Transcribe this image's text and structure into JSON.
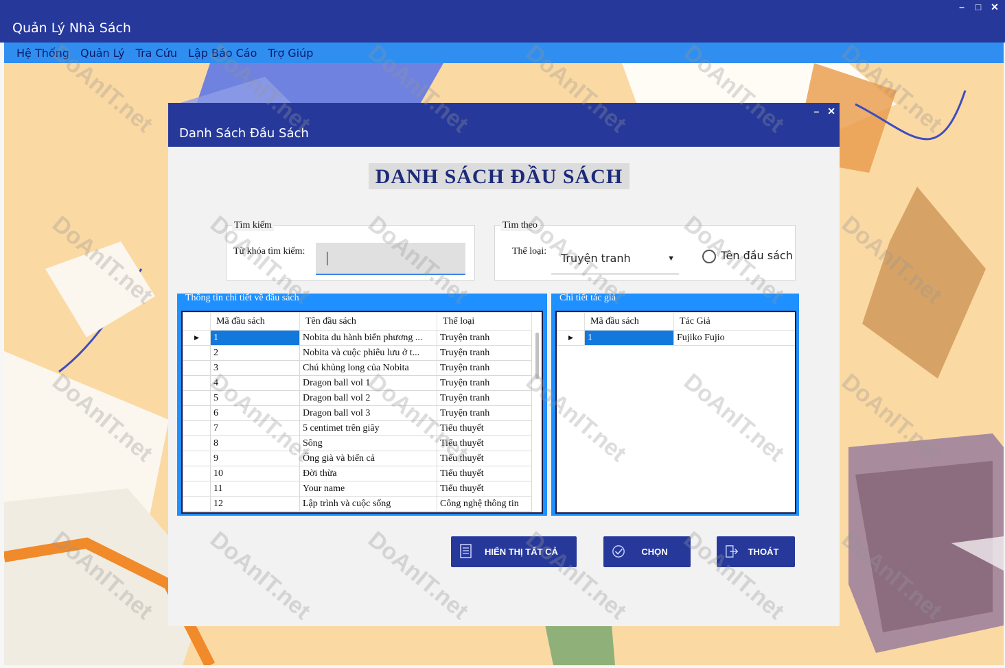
{
  "app": {
    "title": "Quản Lý Nhà Sách",
    "window_controls": [
      "–",
      "□",
      "✕"
    ]
  },
  "menu": [
    "Hệ Thống",
    "Quản Lý",
    "Tra Cứu",
    "Lập Báo Cáo",
    "Trợ Giúp"
  ],
  "dialog": {
    "title": "Danh Sách Đầu Sách",
    "controls": [
      "–",
      "✕"
    ],
    "heading": "DANH SÁCH ĐẦU SÁCH",
    "search": {
      "group": "Tìm kiếm",
      "label": "Từ khóa tìm kiếm:",
      "value": ""
    },
    "filter": {
      "group": "Tìm theo",
      "label": "Thể loại:",
      "selected": "Truyện tranh",
      "radio_label": "Tên đầu sách"
    },
    "books": {
      "group": "Thông tin chi tiết về đầu sách",
      "columns": [
        "Mã đầu sách",
        "Tên đầu sách",
        "Thể loại"
      ],
      "rows": [
        [
          "1",
          "Nobita du hành biển phương ...",
          "Truyện tranh"
        ],
        [
          "2",
          "Nobita và cuộc phiêu lưu ở t...",
          "Truyện tranh"
        ],
        [
          "3",
          "Chú khủng long của Nobita",
          "Truyện tranh"
        ],
        [
          "4",
          "Dragon ball vol 1",
          "Truyện tranh"
        ],
        [
          "5",
          "Dragon ball vol 2",
          "Truyện tranh"
        ],
        [
          "6",
          "Dragon ball vol 3",
          "Truyện tranh"
        ],
        [
          "7",
          "5 centimet trên giây",
          "Tiểu thuyết"
        ],
        [
          "8",
          "Sông",
          "Tiểu thuyết"
        ],
        [
          "9",
          "Ông già và biển cả",
          "Tiểu thuyết"
        ],
        [
          "10",
          "Đời thừa",
          "Tiểu thuyết"
        ],
        [
          "11",
          "Your name",
          "Tiểu thuyết"
        ],
        [
          "12",
          "Lập trình và cuộc sống",
          "Công nghệ thông tin"
        ]
      ]
    },
    "authors": {
      "group": "Chi tiết tác giả",
      "columns": [
        "Mã đầu sách",
        "Tác Giả"
      ],
      "rows": [
        [
          "1",
          "Fujiko Fujio"
        ]
      ]
    },
    "buttons": {
      "show_all": "HIỂN THỊ TẤT CẢ",
      "choose": "CHỌN",
      "exit": "THOÁT"
    }
  },
  "watermark": "DoAnIT.net",
  "colors": {
    "titlebar": "#26399b",
    "menubar": "#2f8ef0",
    "selection": "#1278dc",
    "background": "#fbd9a3"
  }
}
